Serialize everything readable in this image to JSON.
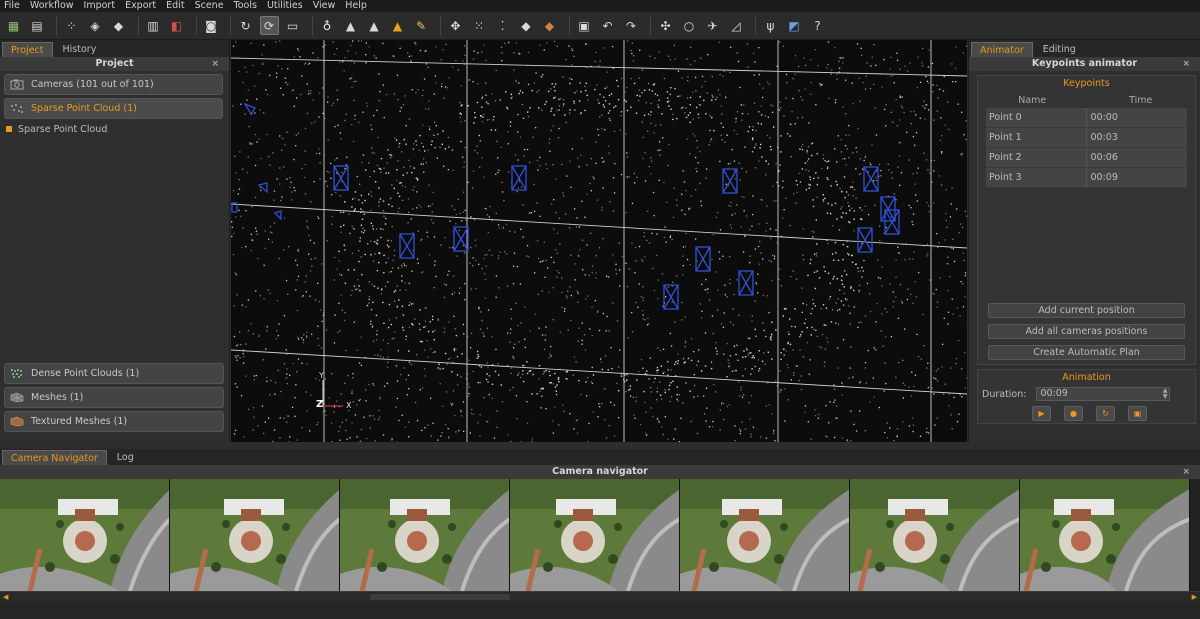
{
  "menu": [
    "File",
    "Workflow",
    "Import",
    "Export",
    "Edit",
    "Scene",
    "Tools",
    "Utilities",
    "View",
    "Help"
  ],
  "toolbar": {
    "icons": [
      "new-project-icon",
      "save-icon",
      "sep",
      "dense-cloud-icon",
      "mesh-icon",
      "textured-mesh-icon",
      "sep",
      "camera-group-icon",
      "cube-red-icon",
      "sep",
      "snapshot-camera-icon",
      "sep",
      "rotate-icon",
      "orbit-icon",
      "home-view-icon",
      "sep",
      "light-bulb-icon",
      "points-icon",
      "triangles-icon",
      "triangles-color-icon",
      "brush-icon",
      "sep",
      "select-icon",
      "point-cloud-icon",
      "sparse-cloud-icon",
      "mesh-view-icon",
      "textured-view-icon",
      "sep",
      "crop-icon",
      "undo-icon",
      "redo-icon",
      "sep",
      "measure-icon",
      "rotate-circle-icon",
      "transform-icon",
      "ruler-icon",
      "sep",
      "wrench-icon",
      "cube-blue-icon",
      "help-icon"
    ]
  },
  "left": {
    "tabs": [
      "Project",
      "History"
    ],
    "title": "Project",
    "items": [
      {
        "label": "Cameras (101 out of 101)",
        "icon": "camera-icon"
      },
      {
        "label": "Sparse Point Cloud (1)",
        "icon": "sparse-cloud-icon"
      }
    ],
    "sub_item": "Sparse Point Cloud",
    "bottom_items": [
      {
        "label": "Dense Point Clouds (1)",
        "icon": "dense-cloud-icon"
      },
      {
        "label": "Meshes (1)",
        "icon": "mesh-icon"
      },
      {
        "label": "Textured Meshes (1)",
        "icon": "textured-mesh-icon"
      }
    ]
  },
  "viewport": {
    "axis_y": "Y",
    "axis_z": "Z",
    "axis_x": "X"
  },
  "right": {
    "tabs": [
      "Animator",
      "Editing"
    ],
    "title": "Keypoints animator",
    "keypoints_title": "Keypoints",
    "col_name": "Name",
    "col_time": "Time",
    "rows": [
      {
        "name": "Point 0",
        "time": "00:00"
      },
      {
        "name": "Point 1",
        "time": "00:03"
      },
      {
        "name": "Point 2",
        "time": "00:06"
      },
      {
        "name": "Point 3",
        "time": "00:09"
      }
    ],
    "btn_add_current": "Add current position",
    "btn_add_all": "Add all cameras positions",
    "btn_auto_plan": "Create Automatic Plan",
    "animation_title": "Animation",
    "duration_label": "Duration:",
    "duration_value": "00:09"
  },
  "bottom": {
    "tabs": [
      "Camera Navigator",
      "Log"
    ],
    "title": "Camera navigator",
    "thumb_count": 7
  },
  "colors": {
    "accent": "#e89a1c",
    "camera_frame": "#2f4fd6"
  }
}
